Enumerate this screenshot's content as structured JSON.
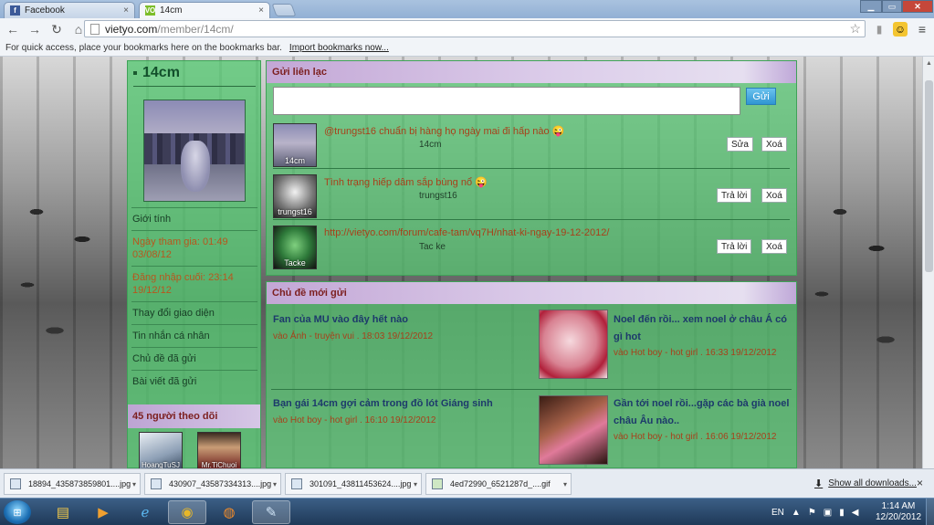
{
  "browser": {
    "tabs": [
      {
        "label": "Facebook",
        "favicon": "f",
        "favicon_color": "#3b5998"
      },
      {
        "label": "14cm",
        "favicon": "VO",
        "favicon_color": "#7cbd2a"
      }
    ],
    "tab_close": "×",
    "url_host": "vietyo.com",
    "url_path": "/member/14cm/",
    "bookmark_hint": "For quick access, place your bookmarks here on the bookmarks bar.",
    "bookmark_import": "Import bookmarks now..."
  },
  "profile": {
    "name": "14cm",
    "menu": [
      {
        "label": "Giới tính",
        "plain": true
      },
      {
        "label": "Ngày tham gia: 01:49 03/08/12",
        "plain": false
      },
      {
        "label": "Đăng nhập cuối: 23:14 19/12/12",
        "plain": false
      },
      {
        "label": "Thay đổi giao diện",
        "plain": true
      },
      {
        "label": "Tin nhắn cá nhân",
        "plain": true
      },
      {
        "label": "Chủ đề đã gửi",
        "plain": true
      },
      {
        "label": "Bài viết đã gửi",
        "plain": true
      }
    ],
    "followers_heading": "45 người theo dõi",
    "followers": [
      {
        "name": "HoangTuSJ"
      },
      {
        "name": "Mr.TiChuoi"
      }
    ]
  },
  "contact": {
    "heading": "Gửi liên lạc",
    "send_label": "Gửi",
    "messages": [
      {
        "avatar_label": "14cm",
        "text": "@trungst16 chuẩn bị hàng họ ngày mai đi hấp nào 😜",
        "author": "14cm",
        "buttons": [
          "Sửa",
          "Xoá"
        ]
      },
      {
        "avatar_label": "trungst16",
        "text": "Tình trạng hiếp dâm sắp bùng nổ 😜",
        "author": "trungst16",
        "buttons": [
          "Trả lời",
          "Xoá"
        ]
      },
      {
        "avatar_label": "Tacke",
        "text": "http://vietyo.com/forum/cafe-tam/vq7H/nhat-ki-ngay-19-12-2012/",
        "author": "Tac ke",
        "buttons": [
          "Trả lời",
          "Xoá"
        ]
      }
    ]
  },
  "topics": {
    "heading": "Chủ đề mới gửi",
    "items": [
      {
        "title": "Fan của MU vào đây hết nào",
        "meta": "vào Ảnh - truyện vui . 18:03 19/12/2012"
      },
      {
        "title": "Noel đến rồi... xem noel ở châu Á có gì hot",
        "meta": "vào Hot boy - hot girl . 16:33 19/12/2012"
      },
      {
        "title": "Bạn gái 14cm gợi cảm trong đồ lót Giáng sinh",
        "meta": "vào Hot boy - hot girl . 16:10 19/12/2012"
      },
      {
        "title": "Gần tới noel rồi...gặp các bà già noel châu Âu nào..",
        "meta": "vào Hot boy - hot girl . 16:06 19/12/2012"
      }
    ]
  },
  "downloads": {
    "items": [
      {
        "name": "18894_435873859801....jpg"
      },
      {
        "name": "430907_43587334313....jpg"
      },
      {
        "name": "301091_43811453624....jpg"
      },
      {
        "name": "4ed72990_6521287d_....gif"
      }
    ],
    "show_all": "Show all downloads...",
    "close": "×"
  },
  "taskbar": {
    "lang": "EN",
    "time": "1:14 AM",
    "date": "12/20/2012"
  }
}
